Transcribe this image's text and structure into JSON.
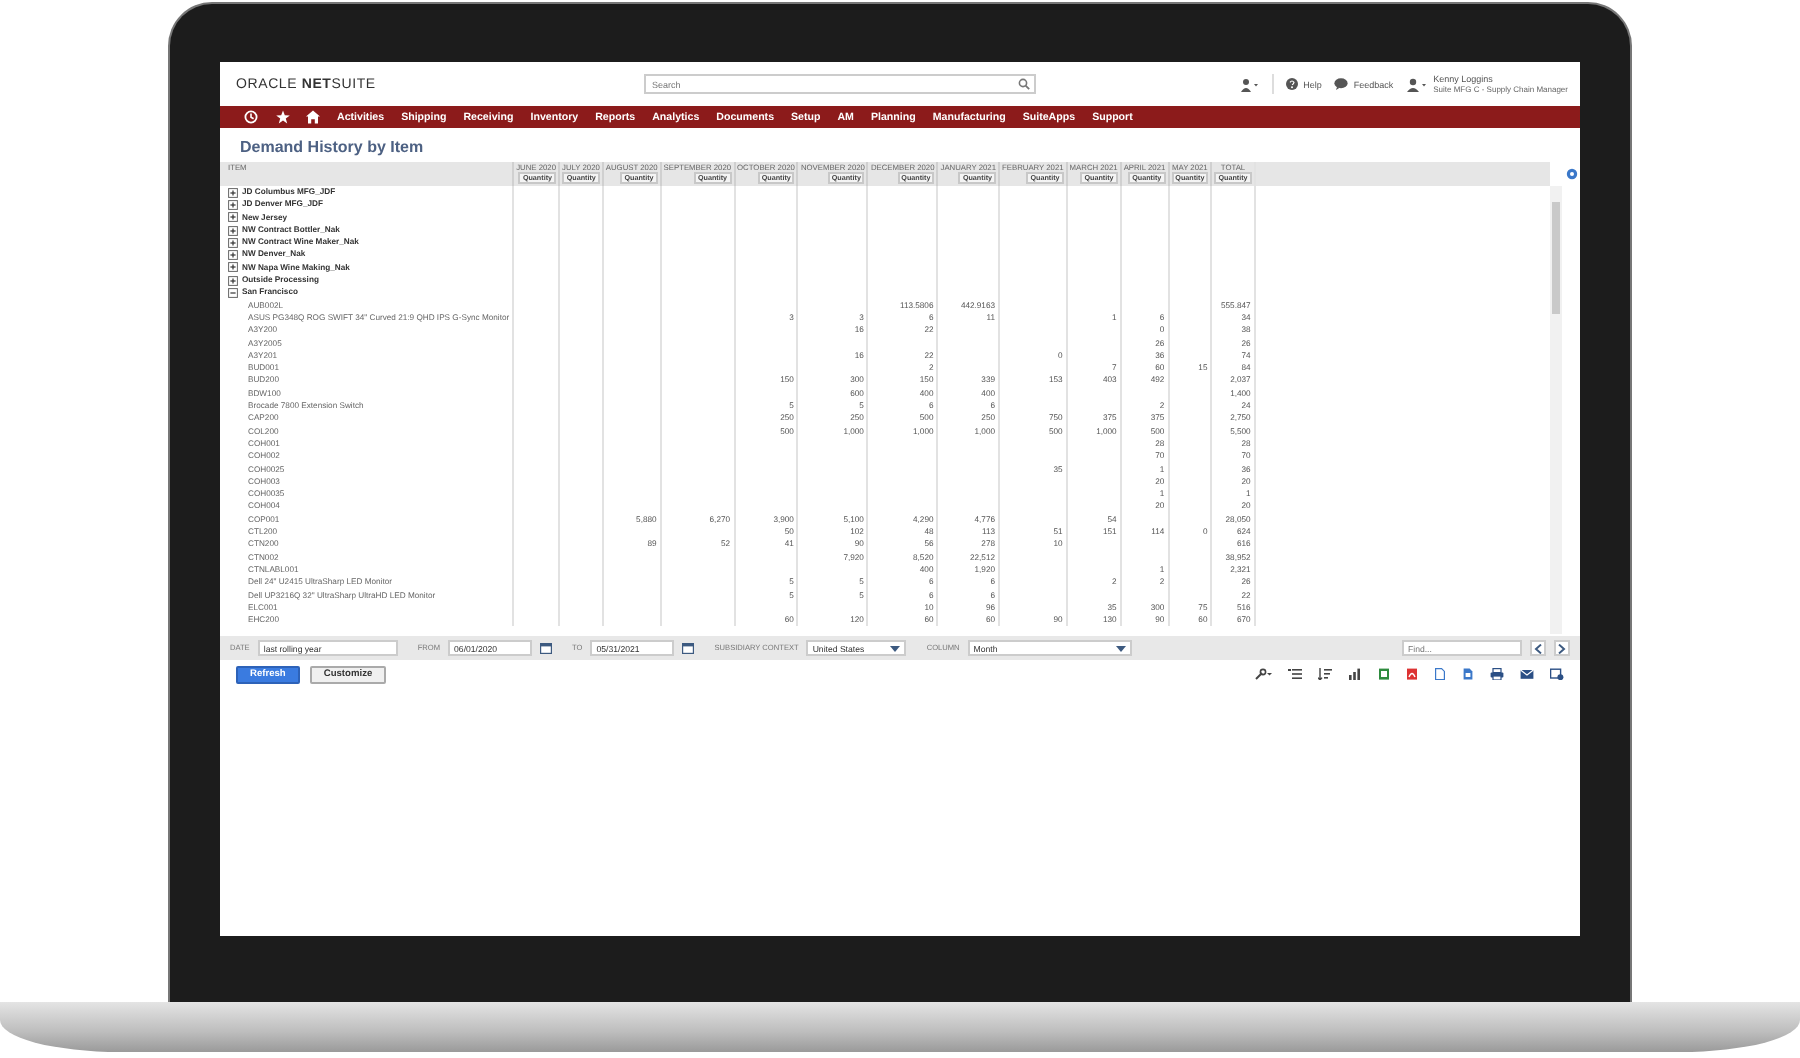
{
  "header": {
    "logo": "ORACLE **NET**SUITE",
    "search": {
      "placeholder": "Search"
    },
    "help": "Help",
    "feedback": "Feedback",
    "user": {
      "name": "Kenny Loggins",
      "role": "Suite MFG C - Supply Chain Manager"
    }
  },
  "nav": [
    "Activities",
    "Shipping",
    "Receiving",
    "Inventory",
    "Reports",
    "Analytics",
    "Documents",
    "Setup",
    "AM",
    "Planning",
    "Manufacturing",
    "SuiteApps",
    "Support"
  ],
  "page_title": "Demand History by Item",
  "report": {
    "columns": [
      {
        "label": "ITEM"
      },
      {
        "label": "JUNE 2020",
        "sublabel": "Quantity"
      },
      {
        "label": "JULY 2020",
        "sublabel": "Quantity"
      },
      {
        "label": "AUGUST 2020",
        "sublabel": "Quantity"
      },
      {
        "label": "SEPTEMBER 2020",
        "sublabel": "Quantity"
      },
      {
        "label": "OCTOBER 2020",
        "sublabel": "Quantity"
      },
      {
        "label": "NOVEMBER 2020",
        "sublabel": "Quantity"
      },
      {
        "label": "DECEMBER 2020",
        "sublabel": "Quantity"
      },
      {
        "label": "JANUARY 2021",
        "sublabel": "Quantity"
      },
      {
        "label": "FEBRUARY 2021",
        "sublabel": "Quantity"
      },
      {
        "label": "MARCH 2021",
        "sublabel": "Quantity"
      },
      {
        "label": "APRIL 2021",
        "sublabel": "Quantity"
      },
      {
        "label": "MAY 2021",
        "sublabel": "Quantity"
      },
      {
        "label": "TOTAL",
        "sublabel": "Quantity"
      }
    ],
    "rows": [
      {
        "item": "JD Columbus MFG_JDF",
        "kind": "group",
        "expanded": false
      },
      {
        "item": "JD Denver MFG_JDF",
        "kind": "group",
        "expanded": false
      },
      {
        "item": "New Jersey",
        "kind": "group",
        "expanded": false
      },
      {
        "item": "NW Contract Bottler_Nak",
        "kind": "group",
        "expanded": false
      },
      {
        "item": "NW Contract Wine Maker_Nak",
        "kind": "group",
        "expanded": false
      },
      {
        "item": "NW Denver_Nak",
        "kind": "group",
        "expanded": false
      },
      {
        "item": "NW Napa Wine Making_Nak",
        "kind": "group",
        "expanded": false
      },
      {
        "item": "Outside Processing",
        "kind": "group",
        "expanded": false
      },
      {
        "item": "San Francisco",
        "kind": "group",
        "expanded": true,
        "children": [
          {
            "item": "AUB002L",
            "kind": "item",
            "quantities": {
              "dec_2020": "113.5806",
              "jan_2021": "442.9163",
              "total": "555.847"
            }
          },
          {
            "item": "ASUS PG348Q ROG SWIFT 34\" Curved 21:9 QHD IPS G-Sync Monitor",
            "kind": "item",
            "quantities": {
              "oct_2020": "3",
              "nov_2020": "3",
              "dec_2020": "6",
              "jan_2021": "11",
              "mar_2021": "1",
              "apr_2021": "6",
              "total": "34"
            }
          },
          {
            "item": "A3Y200",
            "kind": "item",
            "quantities": {
              "nov_2020": "16",
              "dec_2020": "22",
              "apr_2021": "0",
              "total": "38"
            }
          },
          {
            "item": "A3Y2005",
            "kind": "item",
            "quantities": {
              "apr_2021": "26",
              "total": "26"
            }
          },
          {
            "item": "A3Y201",
            "kind": "item",
            "quantities": {
              "nov_2020": "16",
              "dec_2020": "22",
              "feb_2021": "0",
              "apr_2021": "36",
              "total": "74"
            }
          },
          {
            "item": "BUD001",
            "kind": "item",
            "quantities": {
              "dec_2020": "2",
              "mar_2021": "7",
              "apr_2021": "60",
              "may_2021": "15",
              "total": "84"
            }
          },
          {
            "item": "BUD200",
            "kind": "item",
            "quantities": {
              "oct_2020": "150",
              "nov_2020": "300",
              "dec_2020": "150",
              "jan_2021": "339",
              "feb_2021": "153",
              "mar_2021": "403",
              "apr_2021": "492",
              "total": "2,037"
            }
          },
          {
            "item": "BDW100",
            "kind": "item",
            "quantities": {
              "nov_2020": "600",
              "dec_2020": "400",
              "jan_2021": "400",
              "total": "1,400"
            }
          },
          {
            "item": "Brocade 7800 Extension Switch",
            "kind": "item",
            "quantities": {
              "oct_2020": "5",
              "nov_2020": "5",
              "dec_2020": "6",
              "jan_2021": "6",
              "apr_2021": "2",
              "total": "24"
            }
          },
          {
            "item": "CAP200",
            "kind": "item",
            "quantities": {
              "oct_2020": "250",
              "nov_2020": "250",
              "dec_2020": "500",
              "jan_2021": "250",
              "feb_2021": "750",
              "mar_2021": "375",
              "apr_2021": "375",
              "total": "2,750"
            }
          },
          {
            "item": "COL200",
            "kind": "item",
            "quantities": {
              "oct_2020": "500",
              "nov_2020": "1,000",
              "dec_2020": "1,000",
              "jan_2021": "1,000",
              "feb_2021": "500",
              "mar_2021": "1,000",
              "apr_2021": "500",
              "total": "5,500"
            }
          },
          {
            "item": "COH001",
            "kind": "item",
            "quantities": {
              "apr_2021": "28",
              "total": "28"
            }
          },
          {
            "item": "COH002",
            "kind": "item",
            "quantities": {
              "apr_2021": "70",
              "total": "70"
            }
          },
          {
            "item": "COH0025",
            "kind": "item",
            "quantities": {
              "feb_2021": "35",
              "apr_2021": "1",
              "total": "36"
            }
          },
          {
            "item": "COH003",
            "kind": "item",
            "quantities": {
              "apr_2021": "20",
              "total": "20"
            }
          },
          {
            "item": "COH0035",
            "kind": "item",
            "quantities": {
              "apr_2021": "1",
              "total": "1"
            }
          },
          {
            "item": "COH004",
            "kind": "item",
            "quantities": {
              "apr_2021": "20",
              "total": "20"
            }
          },
          {
            "item": "COP001",
            "kind": "item",
            "quantities": {
              "aug_2020": "5,880",
              "sep_2020": "6,270",
              "oct_2020": "3,900",
              "nov_2020": "5,100",
              "dec_2020": "4,290",
              "jan_2021": "4,776",
              "mar_2021": "54",
              "total": "28,050"
            }
          },
          {
            "item": "CTL200",
            "kind": "item",
            "quantities": {
              "oct_2020": "50",
              "nov_2020": "102",
              "dec_2020": "48",
              "jan_2021": "113",
              "feb_2021": "51",
              "mar_2021": "151",
              "apr_2021": "114",
              "may_2021": "0",
              "total": "624"
            }
          },
          {
            "item": "CTN200",
            "kind": "item",
            "quantities": {
              "aug_2020": "89",
              "sep_2020": "52",
              "oct_2020": "41",
              "nov_2020": "90",
              "dec_2020": "56",
              "jan_2021": "278",
              "feb_2021": "10",
              "total": "616"
            }
          },
          {
            "item": "CTN002",
            "kind": "item",
            "quantities": {
              "nov_2020": "7,920",
              "dec_2020": "8,520",
              "jan_2021": "22,512",
              "total": "38,952"
            }
          },
          {
            "item": "CTNLABL001",
            "kind": "item",
            "quantities": {
              "dec_2020": "400",
              "jan_2021": "1,920",
              "apr_2021": "1",
              "total": "2,321"
            }
          },
          {
            "item": "Dell 24\" U2415 UltraSharp LED Monitor",
            "kind": "item",
            "quantities": {
              "oct_2020": "5",
              "nov_2020": "5",
              "dec_2020": "6",
              "jan_2021": "6",
              "mar_2021": "2",
              "apr_2021": "2",
              "total": "26"
            }
          },
          {
            "item": "Dell UP3216Q 32\" UltraSharp UltraHD LED Monitor",
            "kind": "item",
            "quantities": {
              "oct_2020": "5",
              "nov_2020": "5",
              "dec_2020": "6",
              "jan_2021": "6",
              "total": "22"
            }
          },
          {
            "item": "ELC001",
            "kind": "item",
            "quantities": {
              "dec_2020": "10",
              "jan_2021": "96",
              "mar_2021": "35",
              "apr_2021": "300",
              "may_2021": "75",
              "total": "516"
            }
          },
          {
            "item": "EHC200",
            "kind": "item",
            "quantities": {
              "oct_2020": "60",
              "nov_2020": "120",
              "dec_2020": "60",
              "jan_2021": "60",
              "feb_2021": "90",
              "mar_2021": "130",
              "apr_2021": "90",
              "may_2021": "60",
              "total": "670"
            }
          }
        ]
      }
    ]
  },
  "filters": [
    {
      "label": "DATE",
      "value": "last rolling year",
      "kind": "text"
    },
    {
      "label": "FROM",
      "value": "06/01/2020",
      "kind": "date"
    },
    {
      "label": "TO",
      "value": "05/31/2021",
      "kind": "date"
    },
    {
      "label": "SUBSIDIARY CONTEXT",
      "value": "United States",
      "kind": "select"
    },
    {
      "label": "COLUMN",
      "value": "Month",
      "kind": "select"
    }
  ],
  "find": {
    "placeholder": "Find..."
  },
  "buttons": [
    {
      "label": "Refresh",
      "primary": true
    },
    {
      "label": "Customize",
      "primary": false
    }
  ]
}
